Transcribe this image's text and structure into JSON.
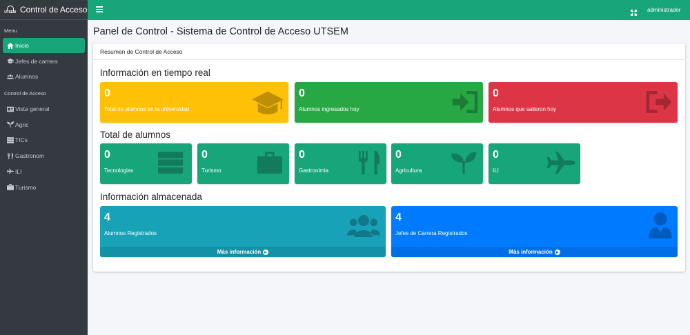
{
  "brand": {
    "logo_text": "UTSEM",
    "title": "Control de Acceso"
  },
  "sidebar": {
    "header_menu": "Menu",
    "header_access": "Control de Acceso",
    "items": [
      {
        "label": "Inicio",
        "icon": "home-icon"
      },
      {
        "label": "Jefes de carrera",
        "icon": "graduation-cap-icon"
      },
      {
        "label": "Alumnos",
        "icon": "users-icon"
      },
      {
        "label": "Vista general",
        "icon": "id-card-icon"
      },
      {
        "label": "Agric",
        "icon": "seedling-icon"
      },
      {
        "label": "TICs",
        "icon": "server-icon"
      },
      {
        "label": "Gastronom",
        "icon": "utensils-icon"
      },
      {
        "label": "ILI",
        "icon": "plane-icon"
      },
      {
        "label": "Turismo",
        "icon": "suitcase-icon"
      }
    ]
  },
  "topbar": {
    "user": "administrador"
  },
  "page": {
    "title": "Panel de Control - Sistema de Control de Acceso UTSEM",
    "card_header": "Resumen de Control de Acceso"
  },
  "realtime": {
    "title": "Información en tiempo real",
    "boxes": [
      {
        "value": "0",
        "label": "Total de alumnos en la universidad",
        "icon": "graduation-cap-icon",
        "color": "#ffc107"
      },
      {
        "value": "0",
        "label": "Alumnos ingresados hoy",
        "icon": "sign-in-icon",
        "color": "#28a745"
      },
      {
        "value": "0",
        "label": "Alumnos que salieron hoy",
        "icon": "sign-out-icon",
        "color": "#dc3545"
      }
    ]
  },
  "totals": {
    "title": "Total de alumnos",
    "boxes": [
      {
        "value": "0",
        "label": "Tecnologias",
        "icon": "server-icon"
      },
      {
        "value": "0",
        "label": "Turismo",
        "icon": "suitcase-icon"
      },
      {
        "value": "0",
        "label": "Gastronimia",
        "icon": "utensils-icon"
      },
      {
        "value": "0",
        "label": "Agricultura",
        "icon": "seedling-icon"
      },
      {
        "value": "0",
        "label": "ILI",
        "icon": "plane-icon"
      }
    ]
  },
  "stored": {
    "title": "Información almacenada",
    "boxes": [
      {
        "value": "4",
        "label": "Alumnos Registrados",
        "footer": "Más información",
        "icon": "users-icon",
        "color": "#17a2b8"
      },
      {
        "value": "4",
        "label": "Jefes de Carrera Registrados",
        "footer": "Más información",
        "icon": "user-tie-icon",
        "color": "#007bff"
      }
    ]
  },
  "colors": {
    "primary": "#17a57a",
    "sidebar": "#343a40"
  }
}
